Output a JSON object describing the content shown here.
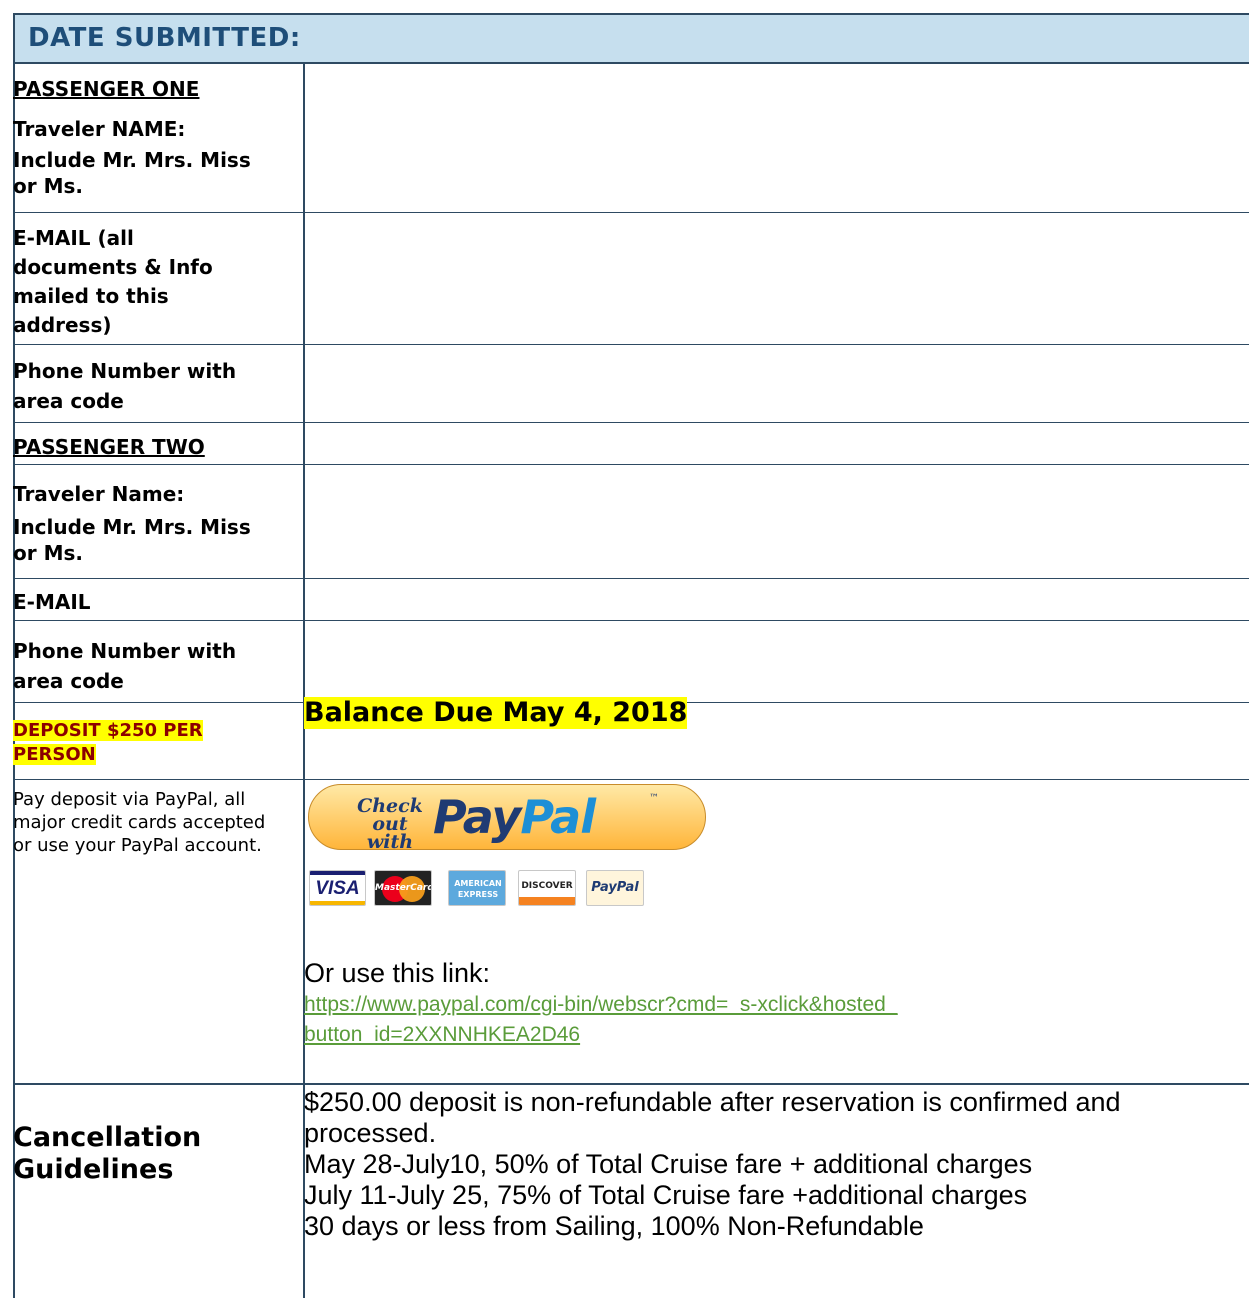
{
  "header": {
    "title": "DATE SUBMITTED:"
  },
  "passenger_one": {
    "heading": "PASSENGER ONE",
    "name_label": "Traveler NAME:",
    "name_hint": "Include Mr. Mrs. Miss or Ms.",
    "email_label": "E-MAIL (all documents & Info mailed to this address)",
    "phone_label": "Phone Number with area code"
  },
  "passenger_two": {
    "heading": "PASSENGER TWO",
    "name_label": "Traveler Name:",
    "name_hint": "Include Mr. Mrs. Miss or Ms.",
    "email_label": "E-MAIL",
    "phone_label": "Phone Number with area code"
  },
  "deposit": {
    "label": "DEPOSIT $250 PER PERSON",
    "balance": "Balance Due May 4, 2018"
  },
  "payment": {
    "instructions": "Pay deposit via PayPal, all major credit cards accepted or use your PayPal account.",
    "paypal_checkout": "Check out with",
    "paypal_pay": "Pay",
    "paypal_pal": "Pal",
    "cards": [
      "VISA",
      "MasterCard",
      "AMERICAN EXPRESS",
      "DISCOVER",
      "PayPal"
    ],
    "or_text": "Or use this link:",
    "link": "https://www.paypal.com/cgi-bin/webscr?cmd=_s-xclick&hosted_button_id=2XXNNHKEA2D46"
  },
  "cancellation": {
    "title": "Cancellation Guidelines",
    "lines": [
      "$250.00 deposit is non-refundable after reservation is confirmed and processed.",
      "May 28-July10, 50% of Total Cruise fare + additional charges",
      "July 11-July 25, 75% of Total Cruise fare +additional charges",
      "30 days or less from Sailing, 100% Non-Refundable"
    ]
  },
  "colors": {
    "header_bg": "#c6dfee",
    "header_text": "#1e4e79",
    "border": "#2e4a62",
    "highlight": "#ffff00",
    "link": "#5a9c3a"
  }
}
